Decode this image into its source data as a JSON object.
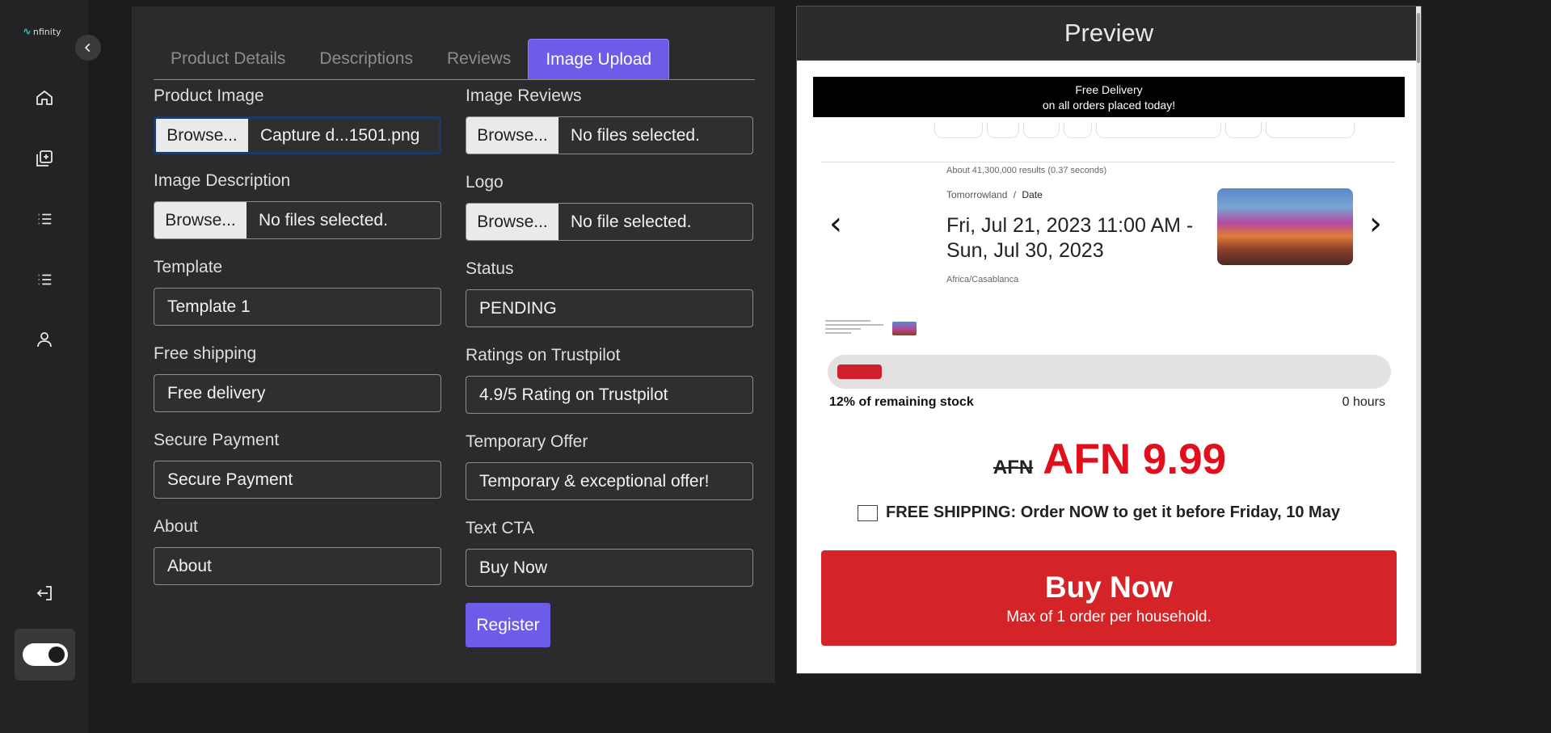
{
  "app": {
    "logo_text": "nfinity"
  },
  "sidebar": {
    "items": [
      {
        "icon": "home-icon"
      },
      {
        "icon": "add-copy-icon"
      },
      {
        "icon": "list-icon"
      },
      {
        "icon": "list-icon"
      },
      {
        "icon": "user-icon"
      }
    ],
    "logout_icon": "logout-icon"
  },
  "tabs": [
    {
      "label": "Product Details",
      "active": false
    },
    {
      "label": "Descriptions",
      "active": false
    },
    {
      "label": "Reviews",
      "active": false
    },
    {
      "label": "Image Upload",
      "active": true
    }
  ],
  "form": {
    "product_image": {
      "label": "Product Image",
      "browse": "Browse...",
      "file": "Capture d...1501.png"
    },
    "image_reviews": {
      "label": "Image Reviews",
      "browse": "Browse...",
      "file": "No files selected."
    },
    "image_description": {
      "label": "Image Description",
      "browse": "Browse...",
      "file": "No files selected."
    },
    "logo": {
      "label": "Logo",
      "browse": "Browse...",
      "file": "No file selected."
    },
    "template": {
      "label": "Template",
      "value": "Template 1"
    },
    "status": {
      "label": "Status",
      "value": "PENDING"
    },
    "free_shipping": {
      "label": "Free shipping",
      "value": "Free delivery"
    },
    "ratings": {
      "label": "Ratings on Trustpilot",
      "value": "4.9/5 Rating on Trustpilot"
    },
    "secure_payment": {
      "label": "Secure Payment",
      "value": "Secure Payment"
    },
    "temporary_offer": {
      "label": "Temporary Offer",
      "value": "Temporary & exceptional offer!"
    },
    "about": {
      "label": "About",
      "value": "About"
    },
    "text_cta": {
      "label": "Text CTA",
      "value": "Buy Now"
    },
    "register_label": "Register"
  },
  "preview": {
    "title": "Preview",
    "banner_line1": "Free Delivery",
    "banner_line2": "on all orders placed today!",
    "results": "About 41,300,000 results (0.37 seconds)",
    "crumb_1": "Tomorrowland",
    "crumb_sep": "/",
    "crumb_2": "Date",
    "event_date": "Fri, Jul 21, 2023 11:00 AM - Sun, Jul 30, 2023",
    "timezone": "Africa/Casablanca",
    "prev_arrow": "‹",
    "next_arrow": "›",
    "stock_percent": 12,
    "stock_text": "12% of remaining stock",
    "hours_text": "0 hours",
    "old_price": "AFN",
    "new_price": "AFN 9.99",
    "shipping_text": "FREE SHIPPING: Order NOW to get it before Friday, 10 May",
    "buy_label": "Buy Now",
    "buy_sub": "Max of 1 order per household."
  },
  "colors": {
    "accent": "#6c5ce7",
    "price_red": "#e10f1c",
    "buy_red": "#d42428"
  }
}
